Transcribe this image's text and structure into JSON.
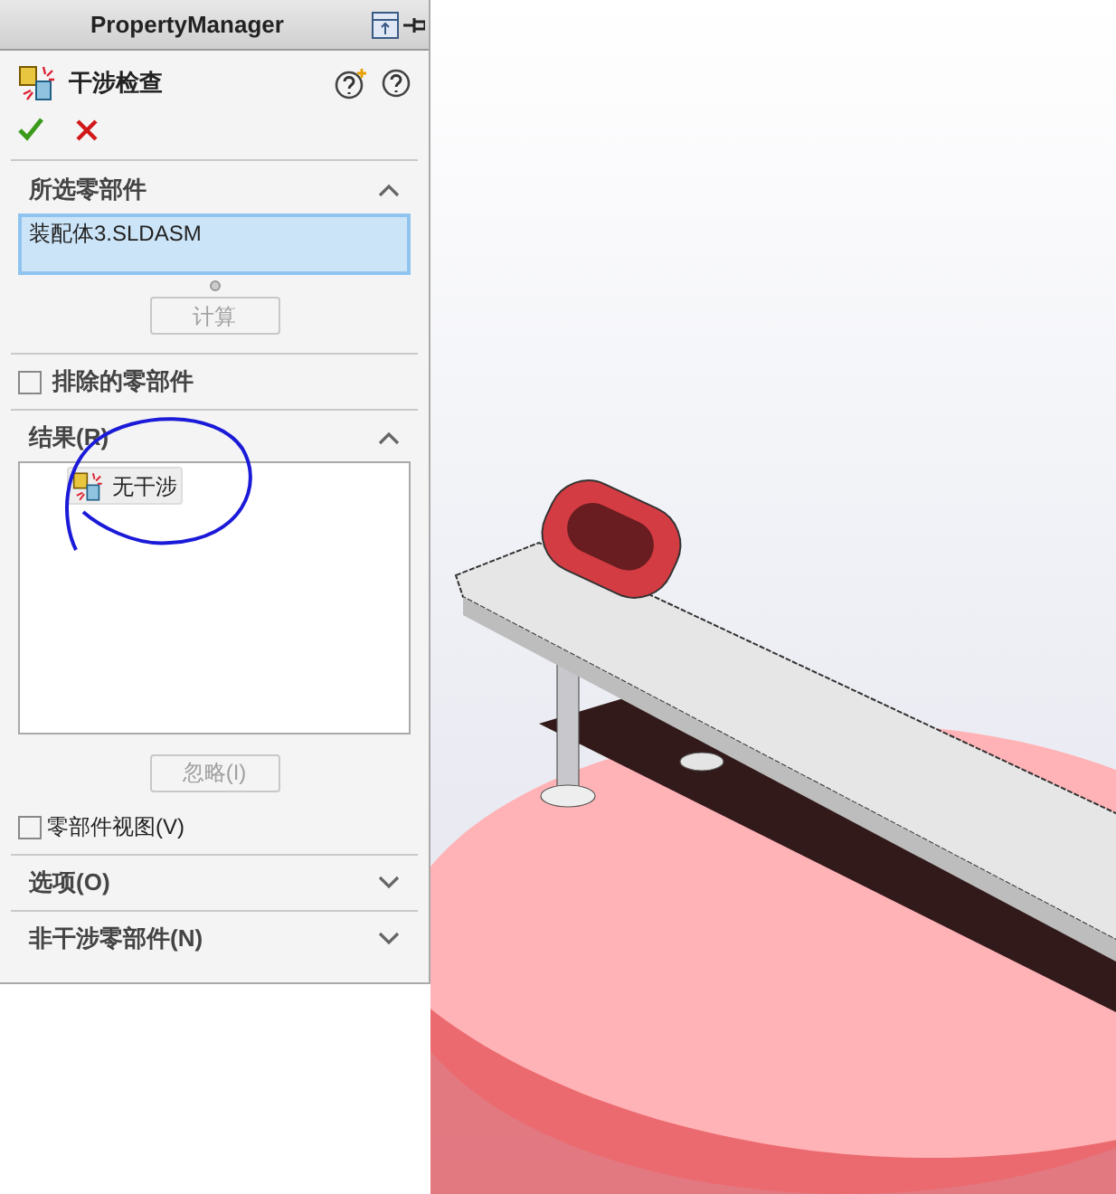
{
  "panel": {
    "title": "PropertyManager"
  },
  "feature": {
    "title": "干涉检查"
  },
  "sections": [
    {
      "kind": "selection",
      "title": "所选零部件",
      "expanded": true,
      "field_value": "装配体3.SLDASM",
      "button": {
        "label": "计算",
        "disabled": true
      }
    },
    {
      "kind": "checkbox",
      "title": "排除的零部件",
      "checked": false
    },
    {
      "kind": "results",
      "title": "结果(R)",
      "expanded": true,
      "results": [
        {
          "label": "无干涉"
        }
      ],
      "button": {
        "label": "忽略(I)",
        "disabled": true
      },
      "option": {
        "label": "零部件视图(V)",
        "checked": false
      }
    },
    {
      "kind": "collapsible",
      "title": "选项(O)",
      "expanded": false
    },
    {
      "kind": "collapsible",
      "title": "非干涉零部件(N)",
      "expanded": false
    }
  ]
}
